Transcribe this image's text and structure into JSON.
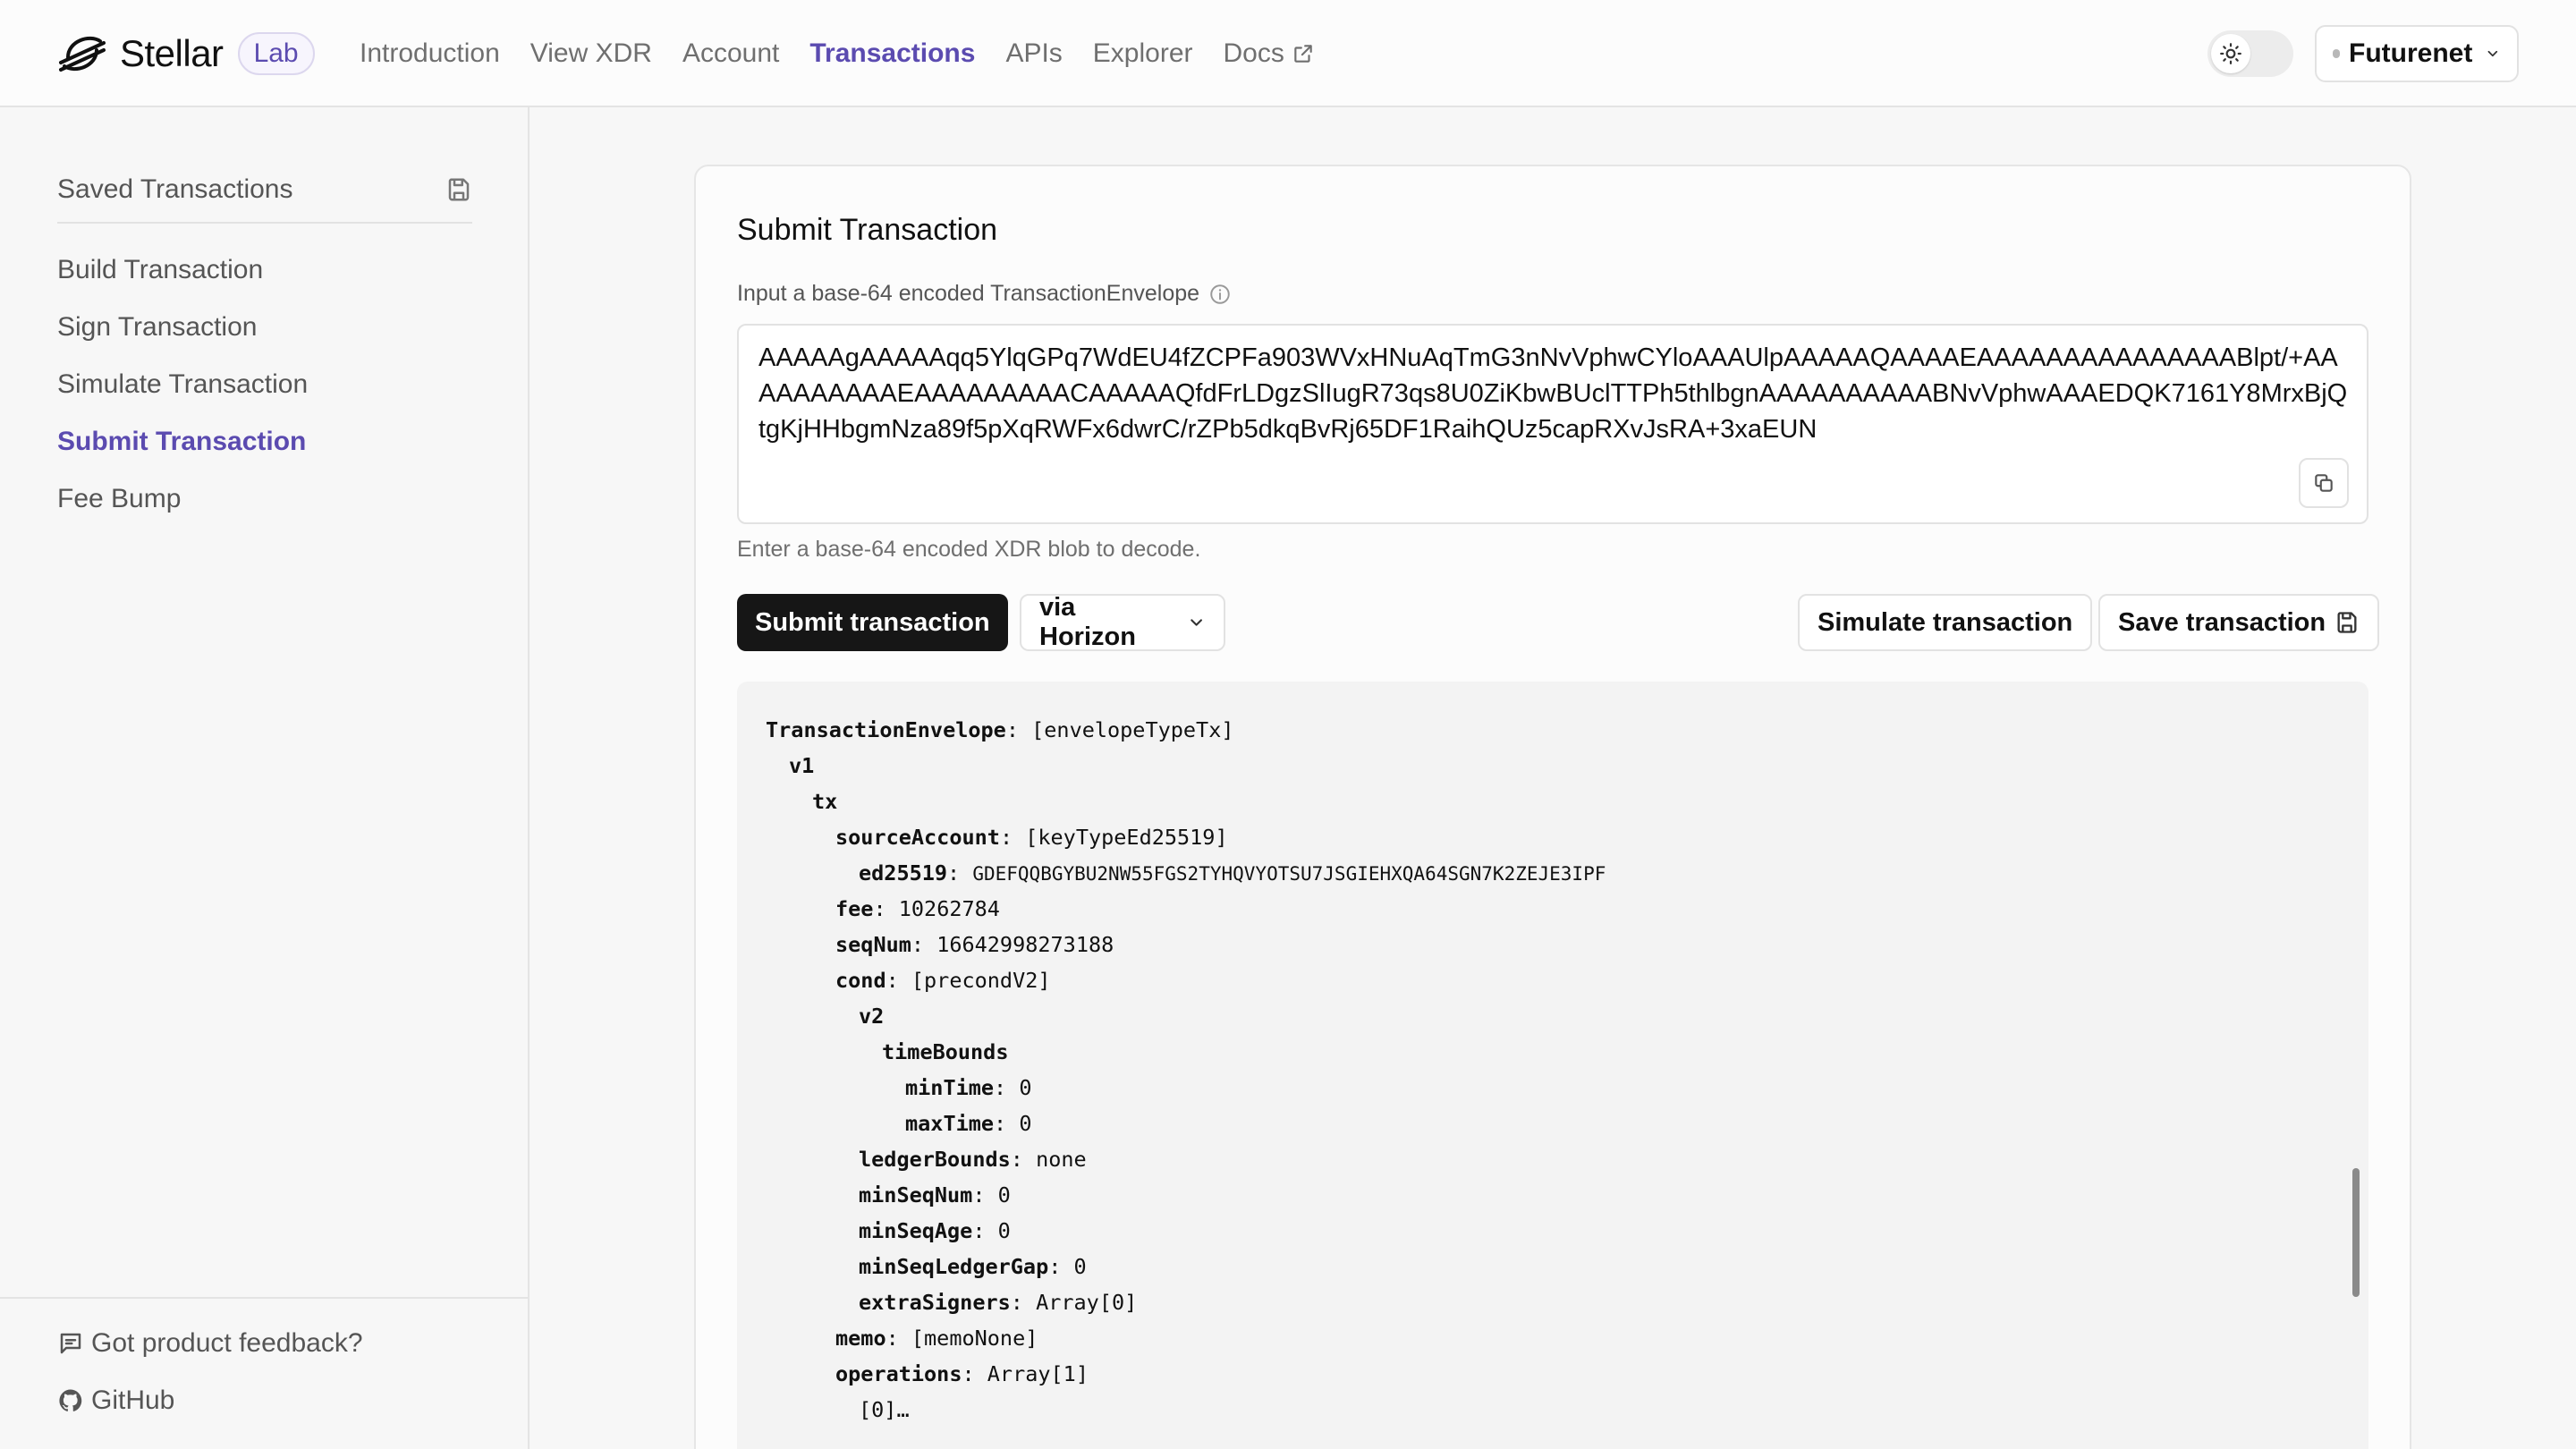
{
  "header": {
    "brand": "Stellar",
    "badge": "Lab",
    "nav": [
      {
        "label": "Introduction"
      },
      {
        "label": "View XDR"
      },
      {
        "label": "Account"
      },
      {
        "label": "Transactions",
        "active": true
      },
      {
        "label": "APIs"
      },
      {
        "label": "Explorer"
      },
      {
        "label": "Docs"
      }
    ],
    "network": "Futurenet"
  },
  "sidebar": {
    "saved_label": "Saved Transactions",
    "items": [
      {
        "label": "Build Transaction"
      },
      {
        "label": "Sign Transaction"
      },
      {
        "label": "Simulate Transaction"
      },
      {
        "label": "Submit Transaction",
        "active": true
      },
      {
        "label": "Fee Bump"
      }
    ],
    "footer": [
      {
        "label": "Got product feedback?"
      },
      {
        "label": "GitHub"
      }
    ]
  },
  "main": {
    "title": "Submit Transaction",
    "input_label": "Input a base-64 encoded TransactionEnvelope",
    "xdr_value": "AAAAAgAAAAAqq5YlqGPq7WdEU4fZCPFa903WVxHNuAqTmG3nNvVphwCYloAAAUlpAAAAAQAAAAEAAAAAAAAAAAAAAABlpt/+AAAAAAAAAAEAAAAAAAAACAAAAAQfdFrLDgzSlIugR73qs8U0ZiKbwBUclTTPh5thlbgnAAAAAAAAAABNvVphwAAAEDQK7161Y8MrxBjQtgKjHHbgmNza89f5pXqRWFx6dwrC/rZPb5dkqBvRj65DF1RaihQUz5capRXvJsRA+3xaEUN",
    "helper": "Enter a base-64 encoded XDR blob to decode.",
    "buttons": {
      "submit": "Submit transaction",
      "via": "via Horizon",
      "simulate": "Simulate transaction",
      "save": "Save transaction"
    },
    "tree": [
      {
        "indent": 0,
        "key": "TransactionEnvelope",
        "value": "[envelopeTypeTx]"
      },
      {
        "indent": 1,
        "key": "v1",
        "value": ""
      },
      {
        "indent": 2,
        "key": "tx",
        "value": ""
      },
      {
        "indent": 3,
        "key": "sourceAccount",
        "value": "[keyTypeEd25519]"
      },
      {
        "indent": 4,
        "key": "ed25519",
        "value": "GDEFQQBGYBU2NW55FGS2TYHQVYOTSU7JSGIEHXQA64SGN7K2ZEJE3IPF",
        "small": true
      },
      {
        "indent": 3,
        "key": "fee",
        "value": "10262784"
      },
      {
        "indent": 3,
        "key": "seqNum",
        "value": "16642998273188"
      },
      {
        "indent": 3,
        "key": "cond",
        "value": "[precondV2]"
      },
      {
        "indent": 4,
        "key": "v2",
        "value": ""
      },
      {
        "indent": 5,
        "key": "timeBounds",
        "value": ""
      },
      {
        "indent": 6,
        "key": "minTime",
        "value": "0"
      },
      {
        "indent": 6,
        "key": "maxTime",
        "value": "0"
      },
      {
        "indent": 4,
        "key": "ledgerBounds",
        "value": "none"
      },
      {
        "indent": 4,
        "key": "minSeqNum",
        "value": "0"
      },
      {
        "indent": 4,
        "key": "minSeqAge",
        "value": "0"
      },
      {
        "indent": 4,
        "key": "minSeqLedgerGap",
        "value": "0"
      },
      {
        "indent": 4,
        "key": "extraSigners",
        "value": "Array[0]"
      },
      {
        "indent": 3,
        "key": "memo",
        "value": "[memoNone]"
      },
      {
        "indent": 3,
        "key": "operations",
        "value": "Array[1]"
      },
      {
        "indent": 4,
        "key": "[0]…",
        "value": "",
        "plain": true
      }
    ]
  }
}
